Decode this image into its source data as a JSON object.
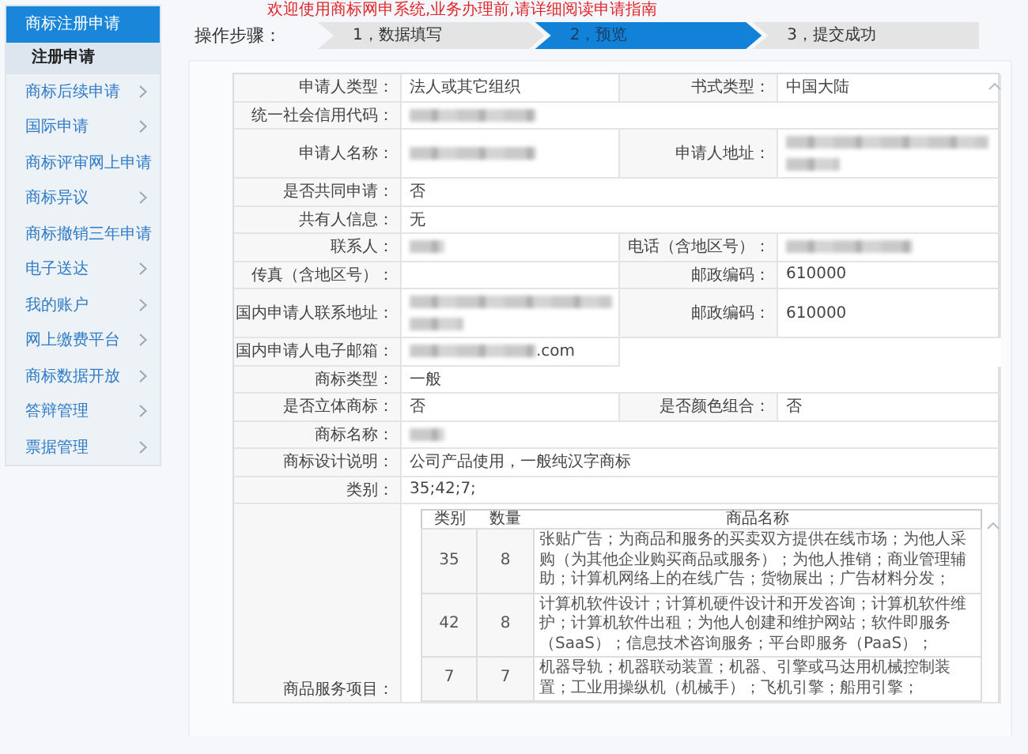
{
  "sidebar": {
    "items": [
      {
        "label": "商标注册申请",
        "selected": true,
        "children": [
          {
            "label": "注册申请",
            "selected": true
          }
        ]
      },
      {
        "label": "商标后续申请",
        "selected": false
      },
      {
        "label": "国际申请",
        "selected": false
      },
      {
        "label": "商标评审网上申请",
        "selected": false
      },
      {
        "label": "商标异议",
        "selected": false
      },
      {
        "label": "商标撤销三年申请",
        "selected": false
      },
      {
        "label": "电子送达",
        "selected": false
      },
      {
        "label": "我的账户",
        "selected": false
      },
      {
        "label": "网上缴费平台",
        "selected": false
      },
      {
        "label": "商标数据开放",
        "selected": false
      },
      {
        "label": "答辩管理",
        "selected": false
      },
      {
        "label": "票据管理",
        "selected": false
      }
    ]
  },
  "notice": "欢迎使用商标网申系统,业务办理前,请详细阅读申请指南",
  "steps": {
    "label": "操作步骤：",
    "items": [
      {
        "label": "1，数据填写",
        "selected": false
      },
      {
        "label": "2，预览",
        "selected": true
      },
      {
        "label": "3，提交成功",
        "selected": false
      }
    ]
  },
  "form": {
    "rows": [
      {
        "kind": "pair",
        "cells": [
          {
            "label": "申请人类型：",
            "value": "法人或其它组织"
          },
          {
            "label": "书式类型：",
            "value": "中国大陆"
          }
        ]
      },
      {
        "kind": "wide",
        "cells": [
          {
            "label": "统一社会信用代码：",
            "kind": "blurline"
          }
        ]
      },
      {
        "kind": "pair",
        "cells": [
          {
            "label": "申请人名称：",
            "kind": "blurline"
          },
          {
            "label": "申请人地址：",
            "kind": "blurblock"
          }
        ]
      },
      {
        "kind": "wide",
        "cells": [
          {
            "label": "是否共同申请：",
            "value": "否"
          }
        ]
      },
      {
        "kind": "wide",
        "cells": [
          {
            "label": "共有人信息：",
            "value": "无"
          }
        ]
      },
      {
        "kind": "pair",
        "cells": [
          {
            "label": "联系人：",
            "kind": "blurshort"
          },
          {
            "label": "电话（含地区号）：",
            "kind": "blurline"
          }
        ]
      },
      {
        "kind": "pair",
        "cells": [
          {
            "label": "传真（含地区号）："
          },
          {
            "label": "邮政编码：",
            "value": "610000"
          }
        ]
      },
      {
        "kind": "pair",
        "cells": [
          {
            "label": "国内申请人联系地址：",
            "kind": "blurblock"
          },
          {
            "label": "邮政编码：",
            "value": "610000"
          }
        ]
      },
      {
        "kind": "half",
        "cells": [
          {
            "label": "国内申请人电子邮箱：",
            "kind": "blurline",
            "value": ".com"
          }
        ]
      },
      {
        "kind": "wide",
        "cells": [
          {
            "label": "商标类型：",
            "value": "一般"
          }
        ]
      },
      {
        "kind": "pair",
        "cells": [
          {
            "label": "是否立体商标：",
            "value": "否"
          },
          {
            "label": "是否颜色组合：",
            "value": "否"
          }
        ]
      },
      {
        "kind": "wide",
        "cells": [
          {
            "label": "商标名称：",
            "kind": "blurshort"
          }
        ]
      },
      {
        "kind": "wide",
        "cells": [
          {
            "label": "商标设计说明：",
            "value": "公司产品使用，一般纯汉字商标"
          }
        ]
      },
      {
        "kind": "wide",
        "cells": [
          {
            "label": "类别：",
            "value": "35;42;7;"
          }
        ]
      },
      {
        "kind": "goods",
        "cells": [
          {
            "label": "商品服务项目："
          }
        ],
        "goods": {
          "columns": [
            "类别",
            "数量",
            "商品名称"
          ],
          "rows": [
            {
              "class": "35",
              "count": "8",
              "names": "张贴广告；为商品和服务的买卖双方提供在线市场；为他人采购（为其他企业购买商品或服务）；为他人推销；商业管理辅助；计算机网络上的在线广告；货物展出；广告材料分发；"
            },
            {
              "class": "42",
              "count": "8",
              "names": "计算机软件设计；计算机硬件设计和开发咨询；计算机软件维护；计算机软件出租；为他人创建和维护网站；软件即服务（SaaS）；信息技术咨询服务；平台即服务（PaaS）；"
            },
            {
              "class": "7",
              "count": "7",
              "names": "机器导轨；机器联动装置；机器、引擎或马达用机械控制装置；工业用操纵机（机械手）；飞机引擎；船用引擎；"
            }
          ]
        }
      }
    ]
  }
}
